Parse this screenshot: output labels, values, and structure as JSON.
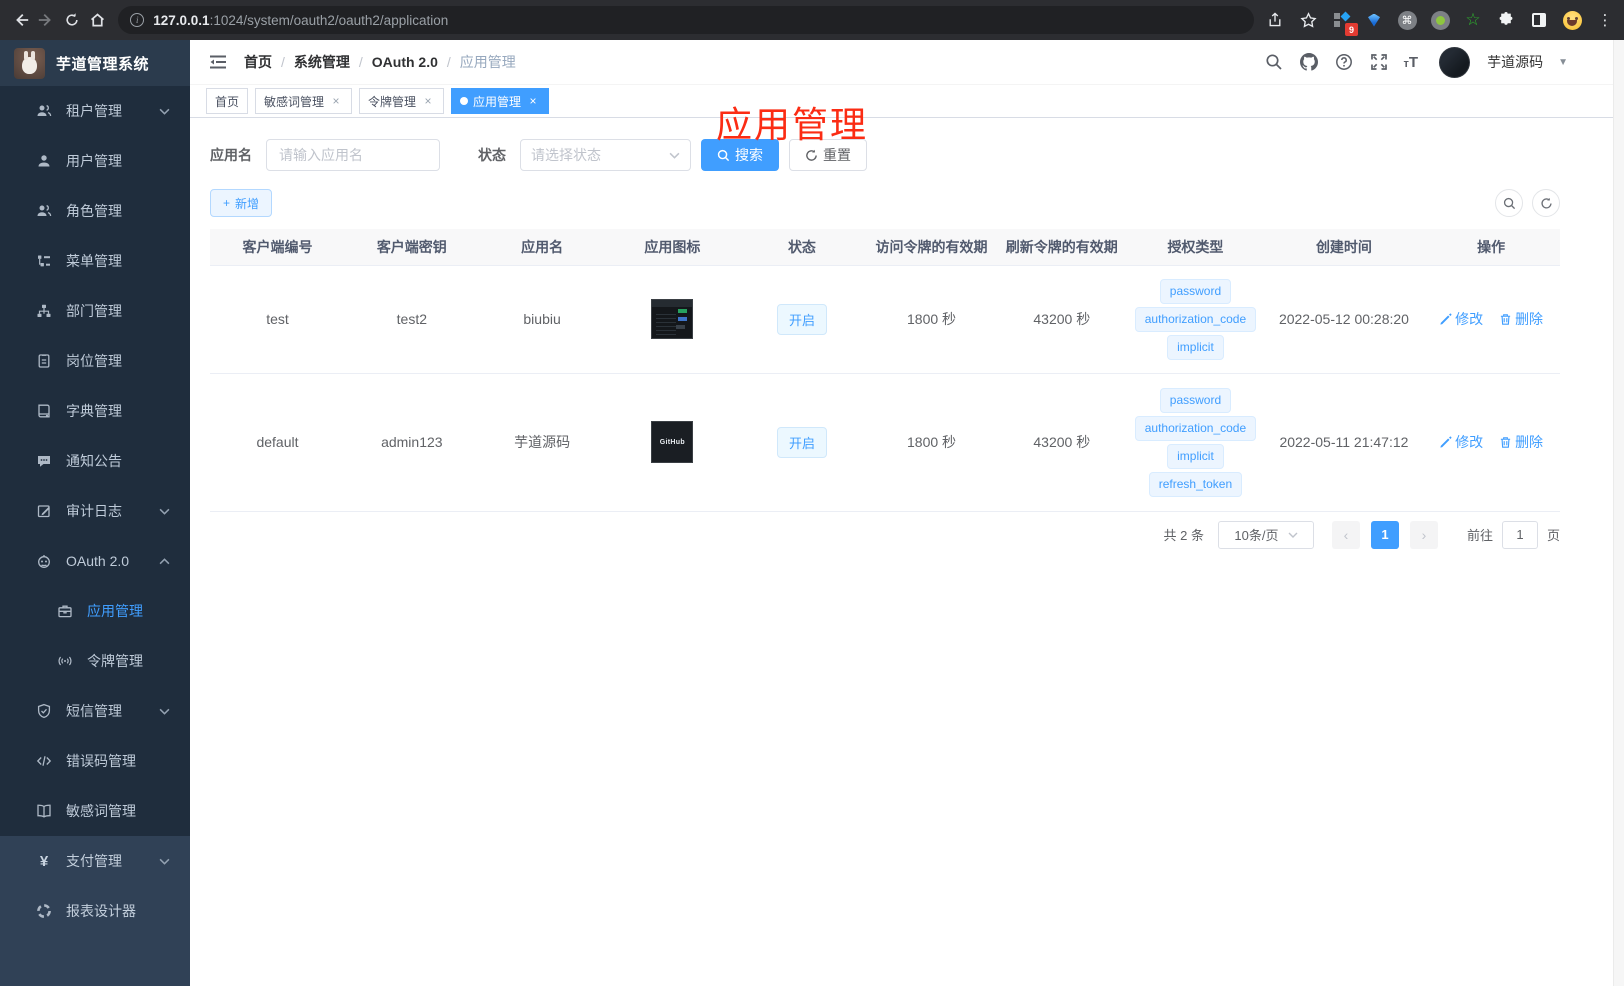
{
  "colors": {
    "accent": "#409eff",
    "annotation": "#fb2c14",
    "sidebar_bg": "#1f2d3d",
    "sidebar_bottom_bg": "#304156",
    "browser_bar": "#2c2d31"
  },
  "browser": {
    "url_host": "127.0.0.1",
    "url_rest": ":1024/system/oauth2/oauth2/application",
    "extension_badge": "9"
  },
  "sidebar": {
    "title": "芋道管理系统",
    "items": [
      {
        "label": "租户管理"
      },
      {
        "label": "用户管理"
      },
      {
        "label": "角色管理"
      },
      {
        "label": "菜单管理"
      },
      {
        "label": "部门管理"
      },
      {
        "label": "岗位管理"
      },
      {
        "label": "字典管理"
      },
      {
        "label": "通知公告"
      },
      {
        "label": "审计日志"
      },
      {
        "label": "OAuth 2.0"
      },
      {
        "label": "应用管理"
      },
      {
        "label": "令牌管理"
      },
      {
        "label": "短信管理"
      },
      {
        "label": "错误码管理"
      },
      {
        "label": "敏感词管理"
      },
      {
        "label": "支付管理"
      },
      {
        "label": "报表设计器"
      }
    ],
    "pay_icon_glyph": "¥"
  },
  "header": {
    "breadcrumbs": [
      "首页",
      "系统管理",
      "OAuth 2.0",
      "应用管理"
    ],
    "separator": "/",
    "username": "芋道源码"
  },
  "annotation": {
    "text": "应用管理"
  },
  "tabs": [
    {
      "label": "首页"
    },
    {
      "label": "敏感词管理"
    },
    {
      "label": "令牌管理"
    },
    {
      "label": "应用管理"
    }
  ],
  "tab_close_glyph": "×",
  "filters": {
    "name_label": "应用名",
    "name_placeholder": "请输入应用名",
    "status_label": "状态",
    "status_placeholder": "请选择状态",
    "search_label": "搜索",
    "reset_label": "重置"
  },
  "toolbar": {
    "add_label": "新增",
    "add_plus": "+"
  },
  "table": {
    "columns": [
      "客户端编号",
      "客户端密钥",
      "应用名",
      "应用图标",
      "状态",
      "访问令牌的有效期",
      "刷新令牌的有效期",
      "授权类型",
      "创建时间",
      "操作"
    ],
    "rows": [
      {
        "client_id": "test",
        "secret": "test2",
        "name": "biubiu",
        "status": "开启",
        "access_ttl": "1800 秒",
        "refresh_ttl": "43200 秒",
        "grant_types": [
          "password",
          "authorization_code",
          "implicit"
        ],
        "created": "2022-05-12 00:28:20"
      },
      {
        "client_id": "default",
        "secret": "admin123",
        "name": "芋道源码",
        "icon_label": "GitHub",
        "status": "开启",
        "access_ttl": "1800 秒",
        "refresh_ttl": "43200 秒",
        "grant_types": [
          "password",
          "authorization_code",
          "implicit",
          "refresh_token"
        ],
        "created": "2022-05-11 21:47:12"
      }
    ],
    "actions": {
      "edit": "修改",
      "delete": "删除"
    }
  },
  "pagination": {
    "total": "共 2 条",
    "page_size": "10条/页",
    "prev": "‹",
    "page": "1",
    "next": "›",
    "goto_label": "前往",
    "goto_value": "1",
    "page_unit": "页"
  }
}
